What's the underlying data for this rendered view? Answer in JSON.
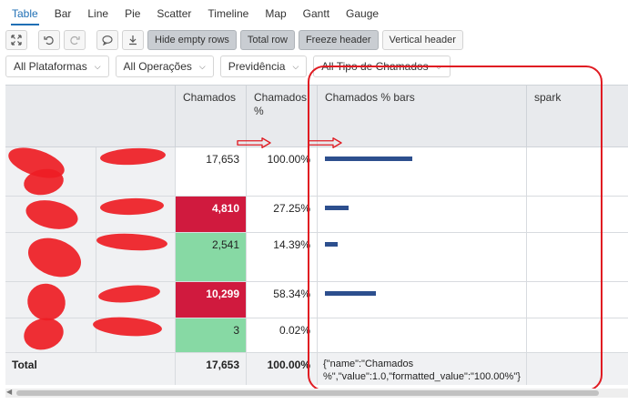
{
  "tabs": [
    {
      "label": "Table",
      "active": true
    },
    {
      "label": "Bar"
    },
    {
      "label": "Line"
    },
    {
      "label": "Pie"
    },
    {
      "label": "Scatter"
    },
    {
      "label": "Timeline"
    },
    {
      "label": "Map"
    },
    {
      "label": "Gantt"
    },
    {
      "label": "Gauge"
    }
  ],
  "toolbar": {
    "icons": [
      "expand-icon",
      "undo-icon",
      "redo-icon",
      "comment-icon",
      "download-icon"
    ],
    "hide_empty_rows": "Hide empty rows",
    "total_row": "Total row",
    "freeze_header": "Freeze header",
    "vertical_header": "Vertical header"
  },
  "filters": [
    "All Plataformas",
    "All Operações",
    "Previdência",
    "All Tipo de Chamados"
  ],
  "table": {
    "headers": {
      "chamados": "Chamados",
      "chamados_pct": "Chamados %",
      "bars": "Chamados % bars",
      "spark": "spark"
    },
    "rows": [
      {
        "chamados": "17,653",
        "pct": "100.00%",
        "pct_value": 1.0,
        "style": "plain"
      },
      {
        "chamados": "4,810",
        "pct": "27.25%",
        "pct_value": 0.2725,
        "style": "red"
      },
      {
        "chamados": "2,541",
        "pct": "14.39%",
        "pct_value": 0.1439,
        "style": "green"
      },
      {
        "chamados": "10,299",
        "pct": "58.34%",
        "pct_value": 0.5834,
        "style": "red"
      },
      {
        "chamados": "3",
        "pct": "0.02%",
        "pct_value": 0.0002,
        "style": "green"
      }
    ],
    "total": {
      "label": "Total",
      "chamados": "17,653",
      "pct": "100.00%",
      "bars_json": "{\"name\":\"Chamados %\",\"value\":1.0,\"formatted_value\":\"100.00%\"}"
    }
  },
  "colors": {
    "accent": "#1f6fb5",
    "bar": "#2d4f8e",
    "red_cell": "#d01a3e",
    "green_cell": "#87d9a4",
    "annotation": "#e01b22"
  }
}
